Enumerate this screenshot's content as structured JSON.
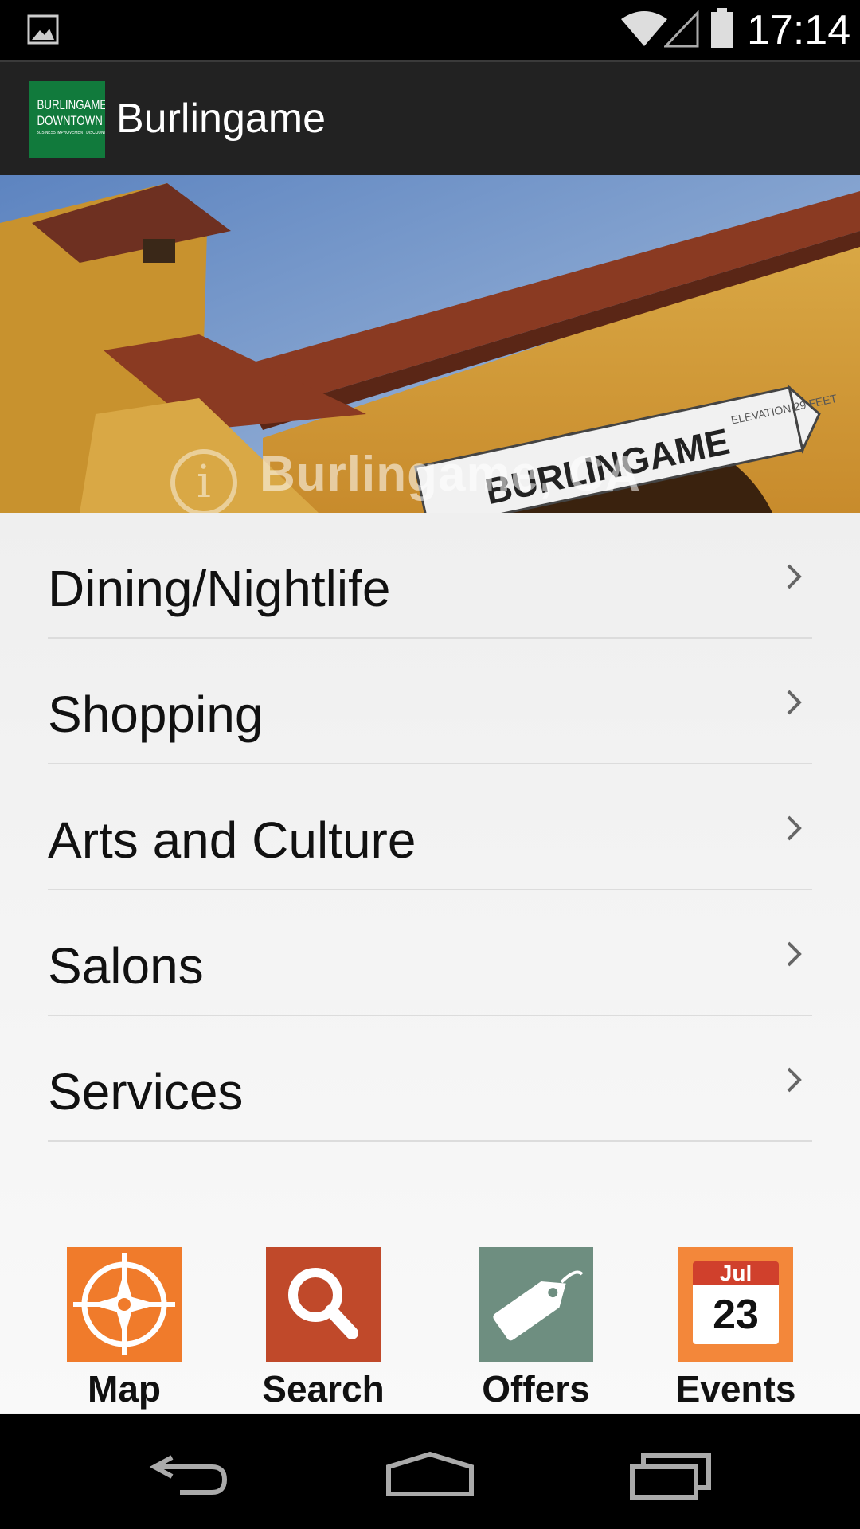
{
  "status_bar": {
    "time": "17:14"
  },
  "action_bar": {
    "title": "Burlingame",
    "logo_line1": "BURLINGAME",
    "logo_line2": "DOWNTOWN",
    "logo_line3": "BUSINESS IMPROVEMENT DISCOUNT"
  },
  "banner": {
    "caption": "Burlingame, CA",
    "info_glyph": "i",
    "sign_text": "BURLINGAME",
    "sign_elevation": "ELEVATION 29 FEET"
  },
  "menu": {
    "items": [
      {
        "label": "Dining/Nightlife"
      },
      {
        "label": "Shopping"
      },
      {
        "label": "Arts and Culture"
      },
      {
        "label": "Salons"
      },
      {
        "label": "Services"
      }
    ]
  },
  "tabs": {
    "map": {
      "label": "Map",
      "color": "#f07b2b",
      "icon": "compass-icon"
    },
    "search": {
      "label": "Search",
      "color": "#c0492a",
      "icon": "search-icon"
    },
    "offers": {
      "label": "Offers",
      "color": "#6e8e80",
      "icon": "tag-icon"
    },
    "events": {
      "label": "Events",
      "color": "#f3873a",
      "icon": "calendar-icon",
      "month": "Jul",
      "day": "23"
    }
  }
}
